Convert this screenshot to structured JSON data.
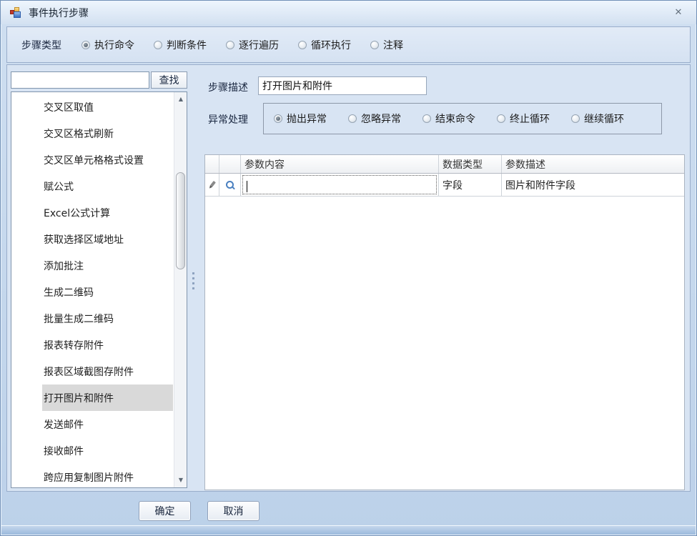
{
  "window": {
    "title": "事件执行步骤"
  },
  "step_type": {
    "label": "步骤类型",
    "options": [
      {
        "label": "执行命令",
        "selected": true
      },
      {
        "label": "判断条件",
        "selected": false
      },
      {
        "label": "逐行遍历",
        "selected": false
      },
      {
        "label": "循环执行",
        "selected": false
      },
      {
        "label": "注释",
        "selected": false
      }
    ]
  },
  "search": {
    "value": "",
    "button_label": "查找"
  },
  "command_list": {
    "selected_index": 11,
    "items": [
      "交叉区取值",
      "交叉区格式刷新",
      "交叉区单元格格式设置",
      "赋公式",
      "Excel公式计算",
      "获取选择区域地址",
      "添加批注",
      "生成二维码",
      "批量生成二维码",
      "报表转存附件",
      "报表区域截图存附件",
      "打开图片和附件",
      "发送邮件",
      "接收邮件",
      "跨应用复制图片附件"
    ]
  },
  "step_desc": {
    "label": "步骤描述",
    "value": "打开图片和附件"
  },
  "exception": {
    "label": "异常处理",
    "options": [
      {
        "label": "抛出异常",
        "selected": true
      },
      {
        "label": "忽略异常",
        "selected": false
      },
      {
        "label": "结束命令",
        "selected": false
      },
      {
        "label": "终止循环",
        "selected": false
      },
      {
        "label": "继续循环",
        "selected": false
      }
    ]
  },
  "params_table": {
    "headers": {
      "content": "参数内容",
      "type": "数据类型",
      "desc": "参数描述"
    },
    "rows": [
      {
        "content": "",
        "type": "字段",
        "desc": "图片和附件字段"
      }
    ]
  },
  "footer": {
    "ok_label": "确定",
    "cancel_label": "取消"
  },
  "colors": {
    "accent_blue": "#4a80c0",
    "selection_gray": "#d9d9d9",
    "frame_blue": "#7190b7"
  }
}
